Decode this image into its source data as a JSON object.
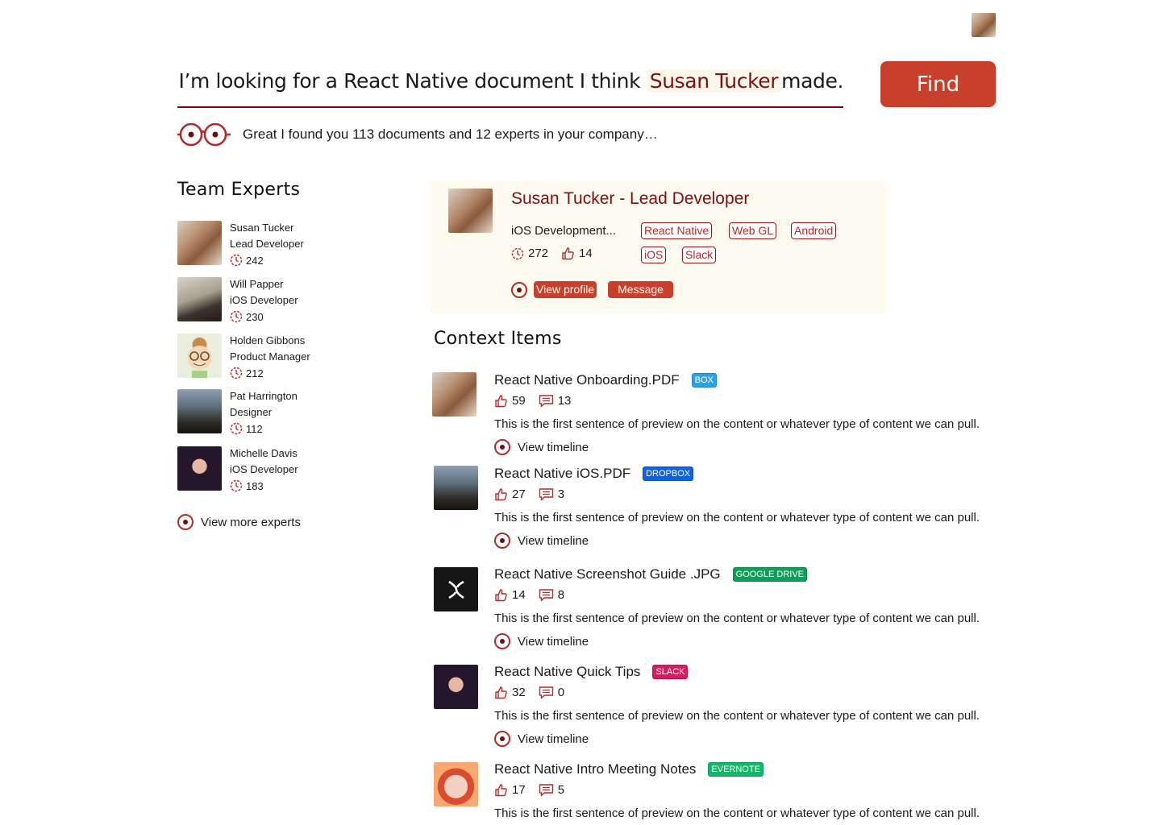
{
  "header": {
    "query_prefix": "I’m looking for a React Native document I think",
    "query_person": "Susan Tucker",
    "query_suffix": "made.",
    "find_label": "Find",
    "result_message": "Great I found you 113 documents and 12 experts in your company…"
  },
  "experts": {
    "heading": "Team Experts",
    "items": [
      {
        "name": "Susan Tucker",
        "role": "Lead Developer",
        "count": "242"
      },
      {
        "name": "Will Papper",
        "role": "iOS Developer",
        "count": "230"
      },
      {
        "name": "Holden Gibbons",
        "role": "Product Manager",
        "count": "212"
      },
      {
        "name": "Pat Harrington",
        "role": "Designer",
        "count": "112"
      },
      {
        "name": "Michelle Davis",
        "role": "iOS Developer",
        "count": "183"
      }
    ],
    "view_more": "View more experts"
  },
  "profile": {
    "title": "Susan Tucker - Lead Developer",
    "subtitle": "iOS Development...",
    "views": "272",
    "likes": "14",
    "tags": [
      "React Native",
      "Web GL",
      "Android",
      "iOS",
      "Slack"
    ],
    "view_profile": "View profile",
    "message": "Message"
  },
  "context": {
    "heading": "Context Items",
    "items": [
      {
        "title": "React Native Onboarding.PDF",
        "source": "BOX",
        "source_color": "#2aa3e6",
        "likes": "59",
        "comments": "13",
        "preview": "This is the first sentence of preview on the content or whatever type of content we can pull.",
        "action": "View timeline"
      },
      {
        "title": "React Native iOS.PDF",
        "source": "DROPBOX",
        "source_color": "#0f62e0",
        "likes": "27",
        "comments": "3",
        "preview": "This is the first sentence of preview on the content or whatever type of content we can pull.",
        "action": "View timeline"
      },
      {
        "title": "React Native Screenshot Guide .JPG",
        "source": "GOOGLE DRIVE",
        "source_color": "#0f9d58",
        "likes": "14",
        "comments": "8",
        "preview": "This is the first sentence of preview on the content or whatever type of content we can pull.",
        "action": "View timeline"
      },
      {
        "title": "React Native Quick Tips",
        "source": "SLACK",
        "source_color": "#d81b60",
        "likes": "32",
        "comments": "0",
        "preview": "This is the first sentence of preview on the content or whatever type of content we can pull.",
        "action": "View timeline"
      },
      {
        "title": "React Native Intro Meeting Notes",
        "source": "EVERNOTE",
        "source_color": "#12b76a",
        "likes": "17",
        "comments": "5",
        "preview": "This is the first sentence of preview on the content or whatever type of content we can pull."
      }
    ]
  },
  "colors": {
    "accent": "#c8402b",
    "dark_red": "#7b1010",
    "card_bg": "#fdfaf0"
  },
  "icons": [
    "user-avatar",
    "binoculars-icon",
    "clock-icon",
    "thumbs-up-icon",
    "comment-icon",
    "target-ring-icon",
    "brand-x-icon"
  ]
}
